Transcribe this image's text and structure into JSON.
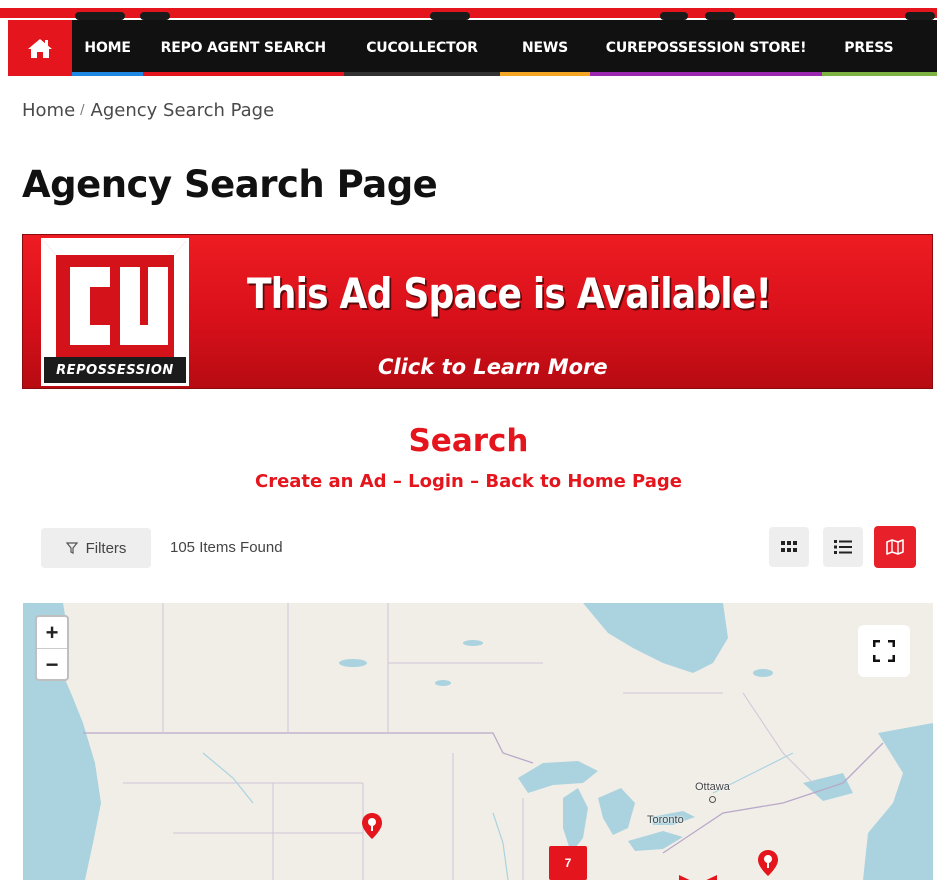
{
  "nav": {
    "items": [
      {
        "label": "HOME",
        "bar_color": "#1e88e5"
      },
      {
        "label": "REPO AGENT SEARCH",
        "bar_color": "#e4151d"
      },
      {
        "label": "CUCOLLECTOR",
        "bar_color": "#333333"
      },
      {
        "label": "NEWS",
        "bar_color": "#f5a623"
      },
      {
        "label": "CUREPOSSESSION STORE!",
        "bar_color": "#9c27b0"
      },
      {
        "label": "PRESS",
        "bar_color": "#7cb342"
      }
    ],
    "home_icon": "home-icon"
  },
  "breadcrumb": {
    "home": "Home",
    "separator": "/",
    "current": "Agency Search Page"
  },
  "page_title": "Agency Search Page",
  "banner": {
    "logo_text": "CU",
    "logo_subtext": "REPOSSESSION",
    "headline": "This Ad Space is Available!",
    "cta": "Click to Learn More"
  },
  "search": {
    "title": "Search",
    "links": {
      "create_ad": "Create an Ad",
      "sep1": " – ",
      "login": "Login",
      "sep2": " –  ",
      "back_home": "Back to Home Page"
    }
  },
  "toolbar": {
    "filters_label": "Filters",
    "items_found": "105 Items Found",
    "views": [
      "grid-icon",
      "list-icon",
      "map-icon"
    ],
    "active_view": "map-icon"
  },
  "map": {
    "zoom_in": "+",
    "zoom_out": "−",
    "cities": [
      "Ottawa",
      "Toronto"
    ],
    "cluster_count": "7",
    "colors": {
      "water": "#aad3df",
      "land": "#f1eee8",
      "marker": "#e4151d"
    }
  }
}
